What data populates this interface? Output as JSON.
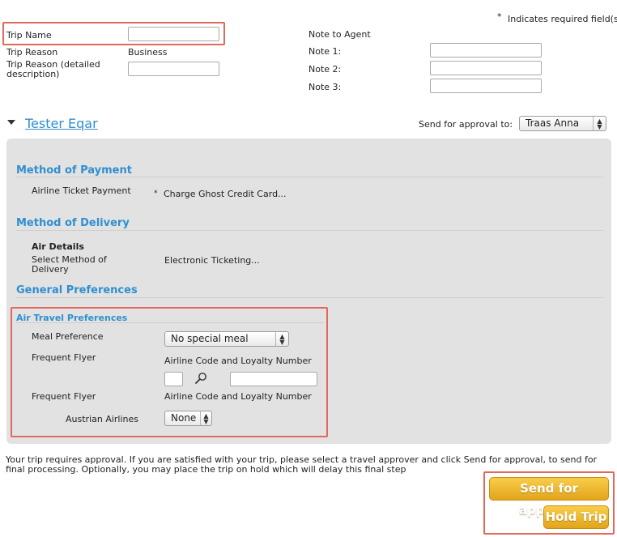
{
  "required_note": {
    "star": "*",
    "text": "Indicates required field(s)"
  },
  "trip": {
    "name_label": "Trip Name",
    "name_value": "",
    "reason_label": "Trip Reason",
    "reason_value": "Business",
    "reason_detail_label": "Trip Reason (detailed description)",
    "reason_detail_value": ""
  },
  "notes": {
    "header": "Note to Agent",
    "note1_label": "Note 1:",
    "note2_label": "Note 2:",
    "note3_label": "Note 3:"
  },
  "traveler": {
    "name": "Tester Eqar",
    "approval_label": "Send for approval to:",
    "approver": "Traas Anna"
  },
  "payment": {
    "title": "Method of Payment",
    "ticket_label": "Airline Ticket Payment",
    "star": "*",
    "ticket_value": "Charge Ghost Credit Card..."
  },
  "delivery": {
    "title": "Method of Delivery",
    "air_details": "Air Details",
    "select_label": "Select Method of Delivery",
    "value": "Electronic Ticketing..."
  },
  "preferences": {
    "title": "General Preferences",
    "air_title": "Air Travel Preferences",
    "meal_label": "Meal Preference",
    "meal_value": "No special meal",
    "ff1_label": "Frequent Flyer",
    "ff1_hint": "Airline Code and Loyalty Number",
    "ff2_label": "Frequent Flyer",
    "ff2_hint": "Airline Code and Loyalty Number",
    "airline_name": "Austrian Airlines",
    "airline_value": "None"
  },
  "approval_message": "Your trip requires approval. If you are satisfied with your trip, please select a travel approver and click Send for approval, to send for final processing. Optionally, you may place the trip on hold which will delay this final step",
  "buttons": {
    "send": "Send for approval",
    "hold": "Hold Trip"
  },
  "colors": {
    "accent_blue": "#2f8fd0",
    "button_gold": "#e8ad22",
    "highlight_red": "#e0695c",
    "panel_gray": "#e2e2e2"
  }
}
